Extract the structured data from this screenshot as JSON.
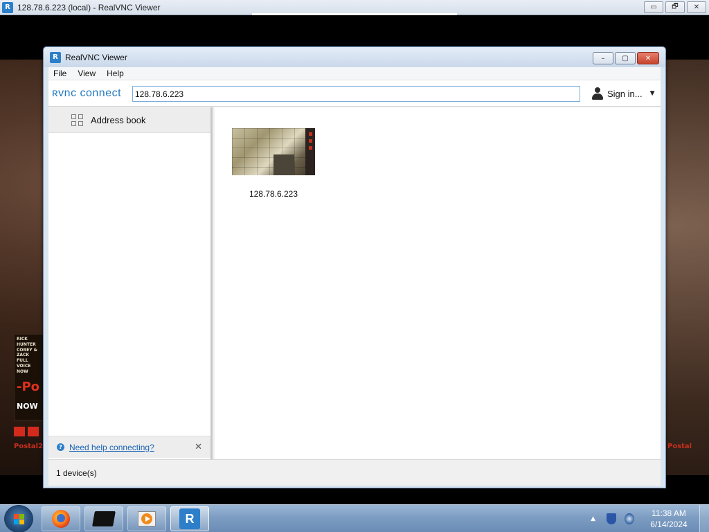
{
  "outer_window": {
    "title": "128.78.6.223 (local) - RealVNC Viewer",
    "controls": {
      "minimize": "▭",
      "restore": "🗗",
      "close": "✕"
    }
  },
  "remote_desktop": {
    "ad_banner": {
      "lines": "RICK HUNTER COREY & ZACK FULL VOICE NOW",
      "big": "-Po",
      "now": "NOW"
    },
    "left_label": "Postal2",
    "right_label": "Postal"
  },
  "viewer": {
    "title": "RealVNC Viewer",
    "controls": {
      "minimize": "–",
      "maximize": "▢",
      "close": "✕"
    },
    "menu": [
      "File",
      "View",
      "Help"
    ],
    "toolbar": {
      "logo": "ʀvnc connect",
      "search_value": "128.78.6.223",
      "signin_label": "Sign in...",
      "signin_caret": "▼"
    },
    "sidebar": {
      "items": [
        {
          "label": "Address book",
          "icon": "grid-icon"
        }
      ],
      "help_link": "Need help connecting?",
      "help_icon": "?",
      "help_close": "✕"
    },
    "devices": [
      {
        "label": "128.78.6.223"
      }
    ],
    "status": "1 device(s)"
  },
  "taskbar": {
    "apps": [
      "firefox-icon",
      "box-icon",
      "media-player-icon",
      "realvnc-icon"
    ],
    "vnc_glyph": "R",
    "tray_arrow": "▲",
    "time": "11:38 AM",
    "date": "6/14/2024"
  }
}
